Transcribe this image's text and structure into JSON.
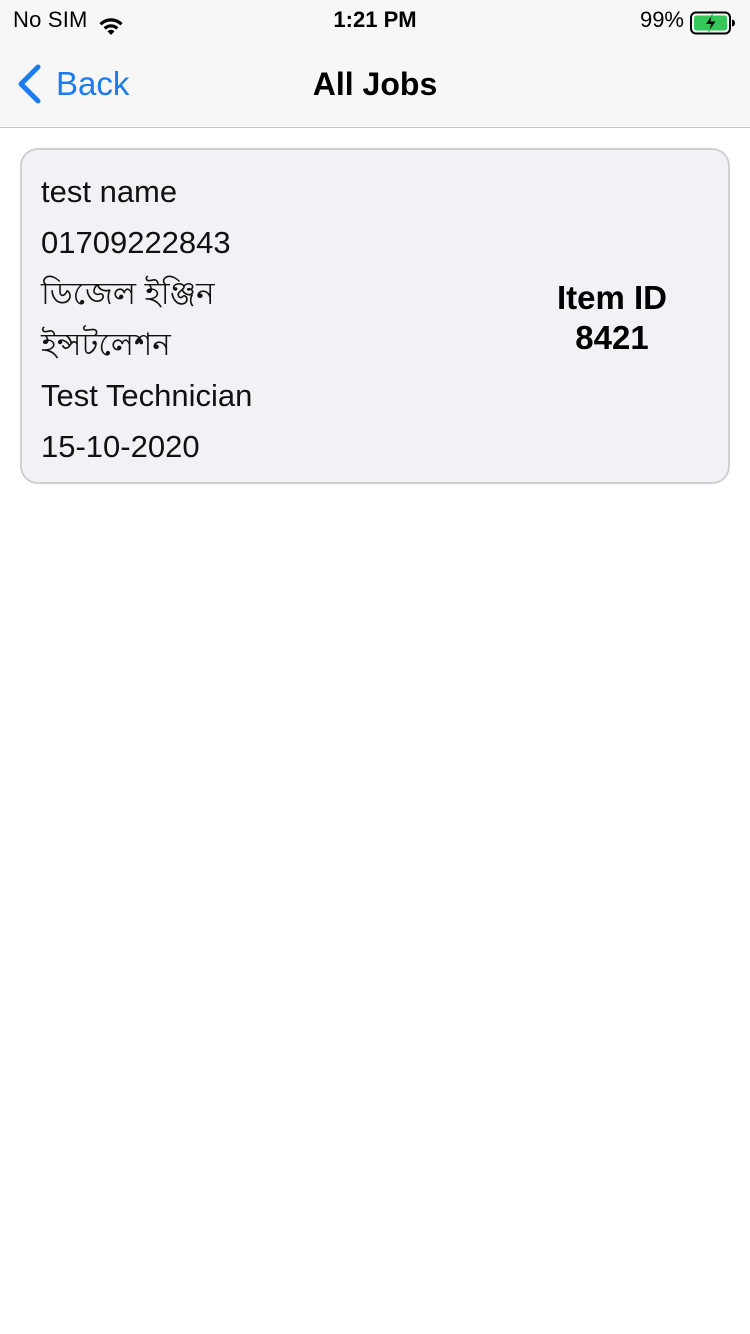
{
  "status_bar": {
    "carrier": "No SIM",
    "time": "1:21 PM",
    "battery_percent": "99%",
    "battery_level": 0.99,
    "battery_charging": true,
    "icons": [
      "wifi-icon",
      "battery-charging-icon"
    ]
  },
  "nav": {
    "back_label": "Back",
    "title": "All Jobs",
    "accent_color": "#1a7cf0"
  },
  "jobs": [
    {
      "customer_name": "test name",
      "phone": "01709222843",
      "service_line1": "ডিজেল ইঞ্জিন",
      "service_line2": "ইন্সটলেশন",
      "technician": "Test Technician",
      "date": "15-10-2020",
      "item_id_label": "Item ID",
      "item_id": "8421"
    }
  ]
}
